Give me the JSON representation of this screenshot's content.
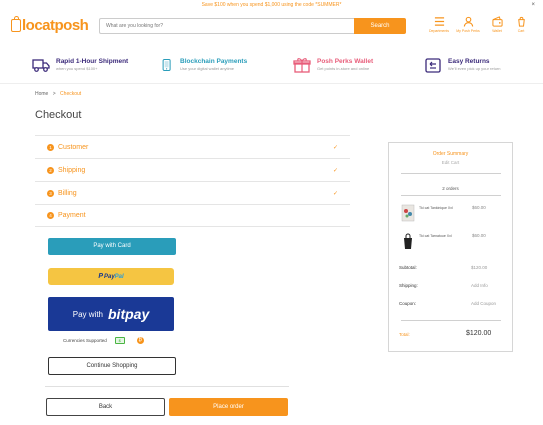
{
  "promo": {
    "text": "Save $100 when you spend $1,000 using the code *SUMMER*",
    "close": "×"
  },
  "header": {
    "logo_text": "locatposh",
    "search": {
      "placeholder": "What are you looking for?",
      "button": "Search"
    },
    "nav": [
      {
        "label": "Departments",
        "icon": "menu-icon"
      },
      {
        "label": "My Posh Perks",
        "icon": "user-icon"
      },
      {
        "label": "Wallet",
        "icon": "wallet-icon"
      },
      {
        "label": "Cart",
        "icon": "cart-icon"
      }
    ]
  },
  "features": [
    {
      "title": "Rapid 1-Hour Shipment",
      "sub": "when you spend $100+",
      "color": "#3b2a7a",
      "icon": "truck-icon"
    },
    {
      "title": "Blockchain Payments",
      "sub": "Use your digital wallet anytime",
      "color": "#2a9dba",
      "icon": "phone-icon"
    },
    {
      "title": "Posh Perks Wallet",
      "sub": "Get points in-store and online",
      "color": "#e85d7a",
      "icon": "gift-icon"
    },
    {
      "title": "Easy Returns",
      "sub": "We'll even pick up your return",
      "color": "#3b2a7a",
      "icon": "return-icon"
    }
  ],
  "breadcrumb": {
    "home": "Home",
    "sep": ">",
    "current": "Checkout"
  },
  "page_title": "Checkout",
  "steps": [
    {
      "num": "1",
      "label": "Customer",
      "check": "✓"
    },
    {
      "num": "2",
      "label": "Shipping",
      "check": "✓"
    },
    {
      "num": "3",
      "label": "Billing",
      "check": "✓"
    },
    {
      "num": "4",
      "label": "Payment",
      "check": ""
    }
  ],
  "payment": {
    "card_label": "Pay with Card",
    "paypal_pre": "Pay",
    "paypal_post": "Pal",
    "bitpay_pre": "Pay with",
    "bitpay_brand": "bitpay",
    "currencies_label": "Currencies Supported",
    "continue_label": "Continue Shopping"
  },
  "actions": {
    "back": "Back",
    "place_order": "Place order"
  },
  "summary": {
    "title": "Order Summary",
    "edit": "Edit Cart",
    "orders": "2 orders",
    "items": [
      {
        "name": "Tki cat Tankinique Xxl",
        "price": "$60.00"
      },
      {
        "name": "Tki cat Tarnatoue Xxl",
        "price": "$60.00"
      }
    ],
    "subtotal_label": "Subtotal:",
    "subtotal": "$120.00",
    "shipping_label": "Shipping:",
    "shipping": "Add Info",
    "coupon_label": "Coupon:",
    "coupon": "Add Coupon",
    "total_label": "Total:",
    "total": "$120.00"
  },
  "colors": {
    "accent": "#f7941d",
    "card": "#2a9dba",
    "paypal": "#f5c542",
    "bitpay": "#1a3996"
  }
}
